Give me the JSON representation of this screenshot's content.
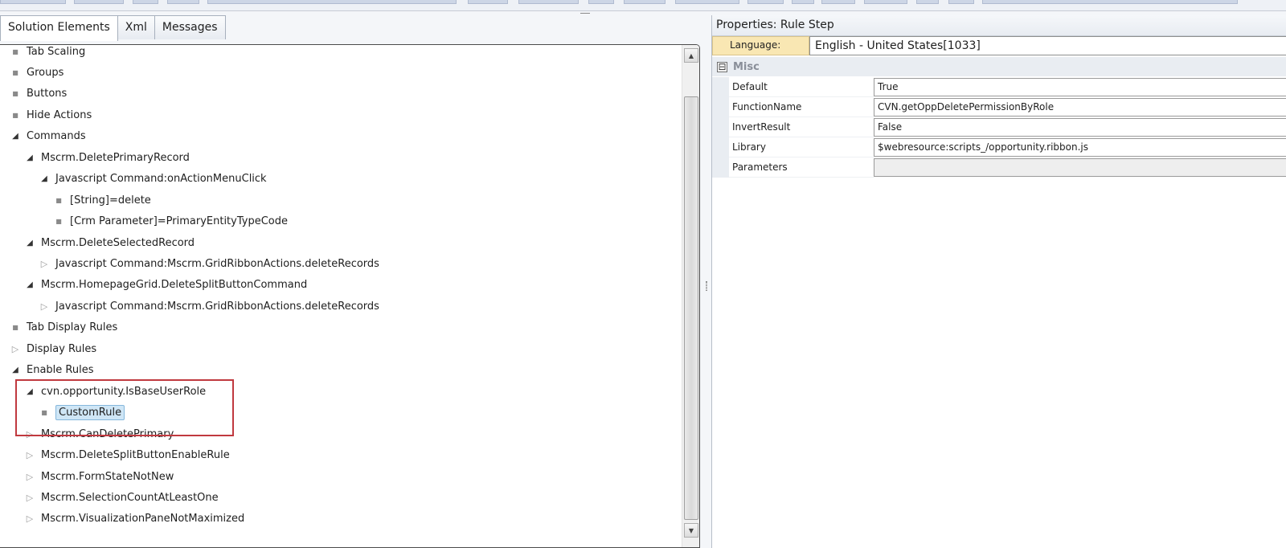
{
  "tabs": [
    {
      "label": "Solution Elements"
    },
    {
      "label": "Xml"
    },
    {
      "label": "Messages"
    }
  ],
  "tree": {
    "nodes": [
      {
        "label": "Tab Scaling",
        "state": "leaf",
        "level": 0
      },
      {
        "label": "Groups",
        "state": "leaf",
        "level": 0
      },
      {
        "label": "Buttons",
        "state": "leaf",
        "level": 0
      },
      {
        "label": "Hide Actions",
        "state": "leaf",
        "level": 0
      },
      {
        "label": "Commands",
        "state": "expanded",
        "level": 0
      },
      {
        "label": "Mscrm.DeletePrimaryRecord",
        "state": "expanded",
        "level": 1
      },
      {
        "label": "Javascript Command:onActionMenuClick",
        "state": "expanded",
        "level": 2
      },
      {
        "label": "[String]=delete",
        "state": "leaf",
        "level": 3
      },
      {
        "label": "[Crm Parameter]=PrimaryEntityTypeCode",
        "state": "leaf",
        "level": 3
      },
      {
        "label": "Mscrm.DeleteSelectedRecord",
        "state": "expanded",
        "level": 1
      },
      {
        "label": "Javascript Command:Mscrm.GridRibbonActions.deleteRecords",
        "state": "collapsed",
        "level": 2
      },
      {
        "label": "Mscrm.HomepageGrid.DeleteSplitButtonCommand",
        "state": "expanded",
        "level": 1
      },
      {
        "label": "Javascript Command:Mscrm.GridRibbonActions.deleteRecords",
        "state": "collapsed",
        "level": 2
      },
      {
        "label": "Tab Display Rules",
        "state": "leaf",
        "level": 0
      },
      {
        "label": "Display Rules",
        "state": "collapsed",
        "level": 0
      },
      {
        "label": "Enable Rules",
        "state": "expanded",
        "level": 0
      },
      {
        "label": "cvn.opportunity.IsBaseUserRole",
        "state": "expanded",
        "level": 1
      },
      {
        "label": "CustomRule",
        "state": "leaf",
        "level": 2,
        "selected": true
      },
      {
        "label": "Mscrm.CanDeletePrimary",
        "state": "collapsed",
        "level": 1
      },
      {
        "label": "Mscrm.DeleteSplitButtonEnableRule",
        "state": "collapsed",
        "level": 1
      },
      {
        "label": "Mscrm.FormStateNotNew",
        "state": "collapsed",
        "level": 1
      },
      {
        "label": "Mscrm.SelectionCountAtLeastOne",
        "state": "collapsed",
        "level": 1
      },
      {
        "label": "Mscrm.VisualizationPaneNotMaximized",
        "state": "collapsed",
        "level": 1
      }
    ]
  },
  "properties": {
    "title": "Properties: Rule Step",
    "language_label": "Language:",
    "language_value": "English - United States[1033]",
    "category": "Misc",
    "category_toggle": "⊟",
    "rows": [
      {
        "name": "Default",
        "value": "True"
      },
      {
        "name": "FunctionName",
        "value": "CVN.getOppDeletePermissionByRole"
      },
      {
        "name": "InvertResult",
        "value": "False"
      },
      {
        "name": "Library",
        "value": "$webresource:scripts_/opportunity.ribbon.js"
      },
      {
        "name": "Parameters",
        "value": ""
      }
    ]
  },
  "colors": {
    "highlight_box": "#c0393f",
    "selection": "#cfe6f6",
    "language_label_bg": "#f9e7b3"
  },
  "icons": {
    "expanded": "expanded-triangle-icon",
    "collapsed": "collapsed-triangle-icon",
    "leaf": "leaf-dot-icon",
    "scroll_up": "scroll-up-icon",
    "scroll_down": "scroll-down-icon"
  }
}
